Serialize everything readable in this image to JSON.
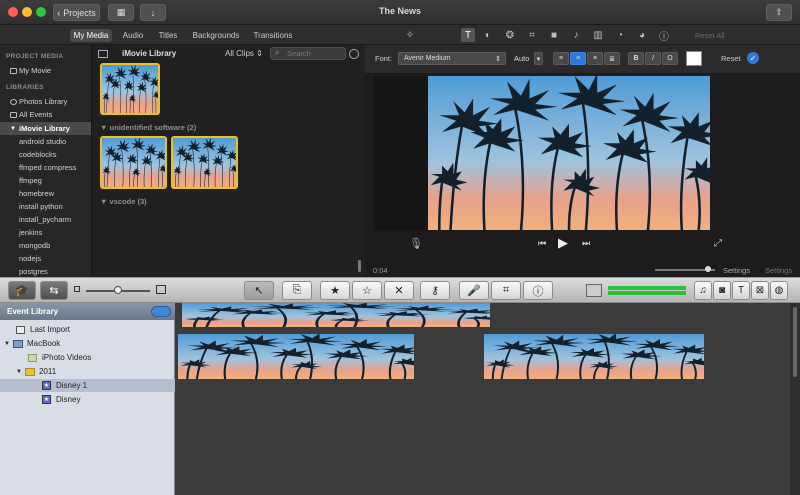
{
  "window": {
    "title": "The News",
    "projects_button": "Projects"
  },
  "media_tabs": [
    "My Media",
    "Audio",
    "Titles",
    "Backgrounds",
    "Transitions"
  ],
  "sidebar": {
    "project_media_header": "PROJECT MEDIA",
    "my_movie": "My Movie",
    "libraries_header": "LIBRARIES",
    "photos_library": "Photos Library",
    "all_events": "All Events",
    "imovie_library": "iMovie Library",
    "events": [
      "android studio",
      "codeblocks",
      "ffmped compress",
      "ffmpeg",
      "homebrew",
      "install python",
      "install_pycharm",
      "jenkins",
      "mongodb",
      "nodejs",
      "postgres"
    ]
  },
  "browser": {
    "library_title": "iMovie Library",
    "filter": "All Clips",
    "search_placeholder": "Search",
    "groups": [
      {
        "label": "unidentified software",
        "count": "(2)"
      },
      {
        "label": "vscode",
        "count": "(3)"
      }
    ]
  },
  "viewer": {
    "reset_all": "Reset All",
    "font_label": "Font:",
    "font_value": "Avenir Medium",
    "size_value": "Auto",
    "style_buttons": [
      "B",
      "I",
      "O"
    ],
    "reset": "Reset",
    "timecode": "0:04",
    "settings": "Settings"
  },
  "event_library": {
    "header": "Event Library",
    "items": [
      {
        "label": "Last Import",
        "indent": 1
      },
      {
        "label": "MacBook",
        "indent": 0
      },
      {
        "label": "iPhoto Videos",
        "indent": 2
      },
      {
        "label": "2011",
        "indent": 1
      },
      {
        "label": "Disney 1",
        "indent": 2,
        "selected": true
      },
      {
        "label": "Disney",
        "indent": 2
      }
    ]
  },
  "colors": {
    "accent": "#2f7ad6",
    "selection_yellow": "#e8c21e",
    "sky_top": "#5fa6d8",
    "sky_bottom": "#f0a27a"
  }
}
